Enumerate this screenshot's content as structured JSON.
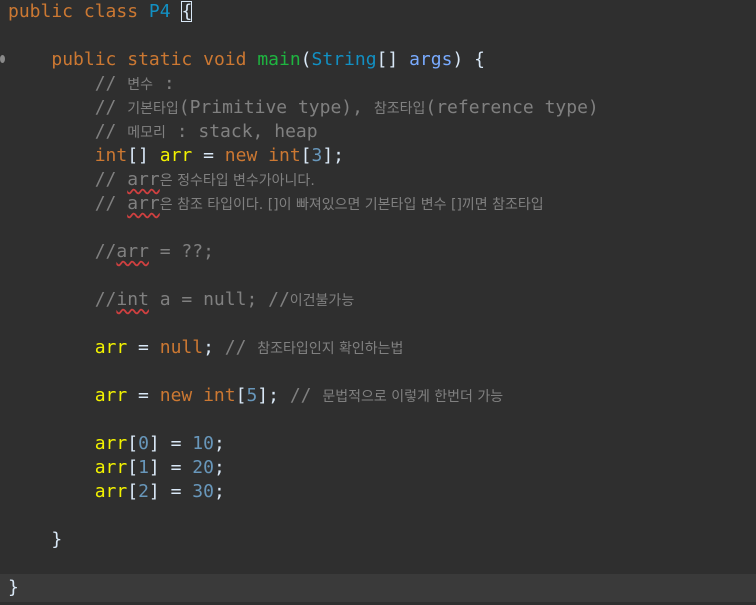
{
  "editor": {
    "class_decl": {
      "kw1": "public",
      "kw2": "class",
      "name": "P4",
      "open_brace": "{"
    },
    "main_decl": {
      "kw1": "public",
      "kw2": "static",
      "kw3": "void",
      "method": "main",
      "paren_open": "(",
      "type": "String",
      "brackets": "[]",
      "param": "args",
      "paren_close": ")",
      "brace": "{"
    },
    "comments": {
      "c1_prefix": "// ",
      "c1_ko": "변수",
      "c1_rest": " :",
      "c2_prefix": "// ",
      "c2_ko1": "기본타입",
      "c2_mid": "(Primitive type), ",
      "c2_ko2": "참조타입",
      "c2_end": "(reference type)",
      "c3_prefix": "// ",
      "c3_ko": "메모리",
      "c3_rest": " : stack, heap"
    },
    "decl_line": {
      "type": "int",
      "brackets": "[]",
      "var": "arr",
      "eq": " = ",
      "new_kw": "new",
      "type2": "int",
      "idx_open": "[",
      "size": "3",
      "idx_close": "];"
    },
    "comment_arr1": {
      "prefix": "// ",
      "var": "arr",
      "ko": "은 정수타입 변수가아니다."
    },
    "comment_arr2": {
      "prefix": "// ",
      "var": "arr",
      "ko": "은 참조 타입이다. []이 빠져있으면 기본타입 변수 []끼면 참조타입"
    },
    "comment_q": {
      "prefix": "//",
      "var": "arr",
      "rest": " = ??;"
    },
    "comment_int": {
      "prefix": "//",
      "kw": "int",
      "rest": " a = null; //",
      "ko": "이건불가능"
    },
    "null_line": {
      "var": "arr",
      "eq": " = ",
      "kw": "null",
      "semi": ";",
      "cmt_prefix": " // ",
      "cmt_ko": "참조타입인지 확인하는법"
    },
    "new_line": {
      "var": "arr",
      "eq": " = ",
      "kw": "new",
      "type": "int",
      "idx_open": "[",
      "size": "5",
      "idx_close": "];",
      "cmt_prefix": " // ",
      "cmt_ko": "문법적으로 이렇게 한번더 가능"
    },
    "assign": [
      {
        "var": "arr",
        "open": "[",
        "index": "0",
        "close": "]",
        "eq": " = ",
        "value": "10",
        "semi": ";"
      },
      {
        "var": "arr",
        "open": "[",
        "index": "1",
        "close": "]",
        "eq": " = ",
        "value": "20",
        "semi": ";"
      },
      {
        "var": "arr",
        "open": "[",
        "index": "2",
        "close": "]",
        "eq": " = ",
        "value": "30",
        "semi": ";"
      }
    ],
    "method_close": "}",
    "class_close": "}",
    "colors": {
      "background": "#2f2f2f",
      "keyword": "#cc7832",
      "type": "#1290c3",
      "method": "#1eb540",
      "local_var": "#f2f200",
      "number": "#6897bb",
      "comment": "#808080"
    }
  }
}
